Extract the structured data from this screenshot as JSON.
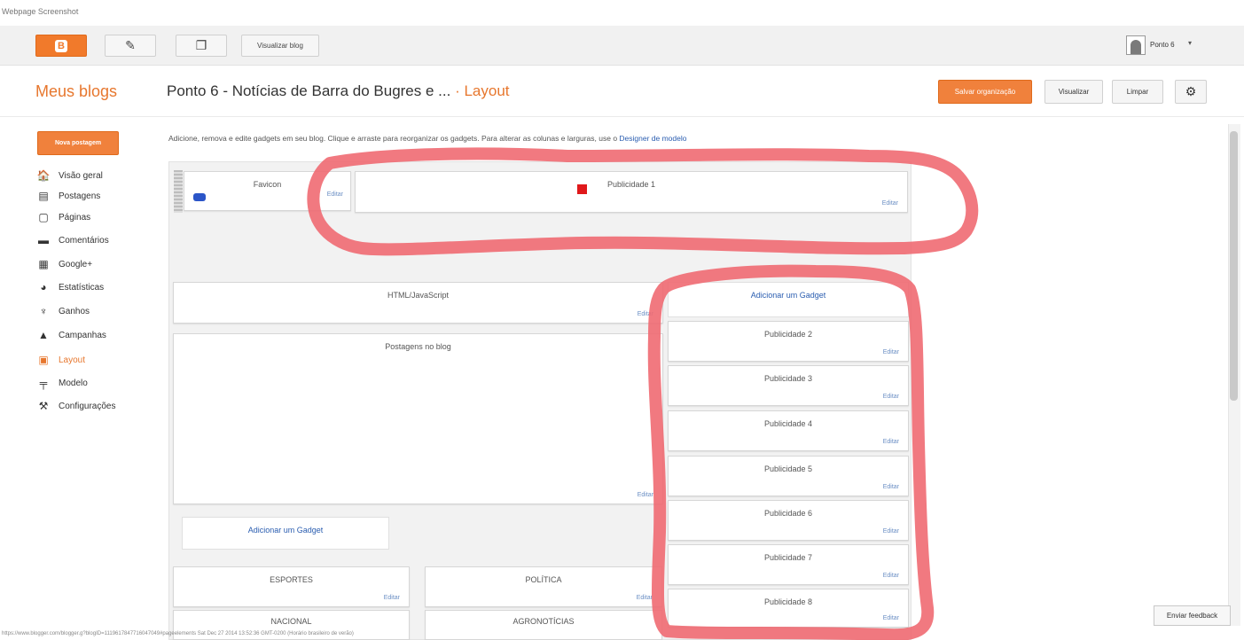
{
  "caption": "Webpage Screenshot",
  "topbar": {
    "view_blog": "Visualizar blog",
    "user_name": "Ponto 6",
    "user_caret": "▾"
  },
  "header": {
    "meus_blogs": "Meus blogs",
    "blog_title": "Ponto 6 - Notícias de Barra do Bugres e ...",
    "separator": " · ",
    "section": "Layout",
    "save_label": "Salvar organização",
    "preview_label": "Visualizar",
    "clear_label": "Limpar"
  },
  "sidebar": {
    "new_post": "Nova postagem",
    "items": [
      {
        "label": "Visão geral",
        "icon": "home-icon",
        "glyph": "🏠"
      },
      {
        "label": "Postagens",
        "icon": "posts-icon",
        "glyph": "▤"
      },
      {
        "label": "Páginas",
        "icon": "pages-icon",
        "glyph": "▢"
      },
      {
        "label": "Comentários",
        "icon": "comments-icon",
        "glyph": "▬"
      },
      {
        "label": "Google+",
        "icon": "google-plus-icon",
        "glyph": "▦"
      },
      {
        "label": "Estatísticas",
        "icon": "stats-icon",
        "glyph": "◕"
      },
      {
        "label": "Ganhos",
        "icon": "trophy-icon",
        "glyph": "♆"
      },
      {
        "label": "Campanhas",
        "icon": "campaigns-icon",
        "glyph": "▲"
      },
      {
        "label": "Layout",
        "icon": "layout-icon",
        "glyph": "▣"
      },
      {
        "label": "Modelo",
        "icon": "template-icon",
        "glyph": "╤"
      },
      {
        "label": "Configurações",
        "icon": "wrench-icon",
        "glyph": "⚒"
      }
    ]
  },
  "instructions": {
    "text": "Adicione, remova e edite gadgets em seu blog. Clique e arraste para reorganizar os gadgets. Para alterar as colunas e larguras, use o ",
    "link": "Designer de modelo"
  },
  "gadgets": {
    "edit_label": "Editar",
    "add_gadget": "Adicionar um Gadget",
    "favicon": "Favicon",
    "pub1": "Publicidade 1",
    "html_js": "HTML/JavaScript",
    "posts": "Postagens no blog",
    "pub2": "Publicidade 2",
    "pub3": "Publicidade 3",
    "pub4": "Publicidade 4",
    "pub5": "Publicidade 5",
    "pub6": "Publicidade 6",
    "pub7": "Publicidade 7",
    "pub8": "Publicidade 8",
    "esportes": "ESPORTES",
    "politica": "POLÍTICA",
    "nacional": "NACIONAL",
    "agronoticias": "AGRONOTÍCIAS"
  },
  "feedback": "Enviar feedback",
  "footer_url": "https://www.blogger.com/blogger.g?blogID=1119617847716047049#pageelements Sat Dec 27 2014 13:52:36 GMT-0200 (Horário brasileiro de verão)",
  "colors": {
    "accent": "#f0813c",
    "annotation": "#f06a72",
    "link": "#2a5db0"
  }
}
